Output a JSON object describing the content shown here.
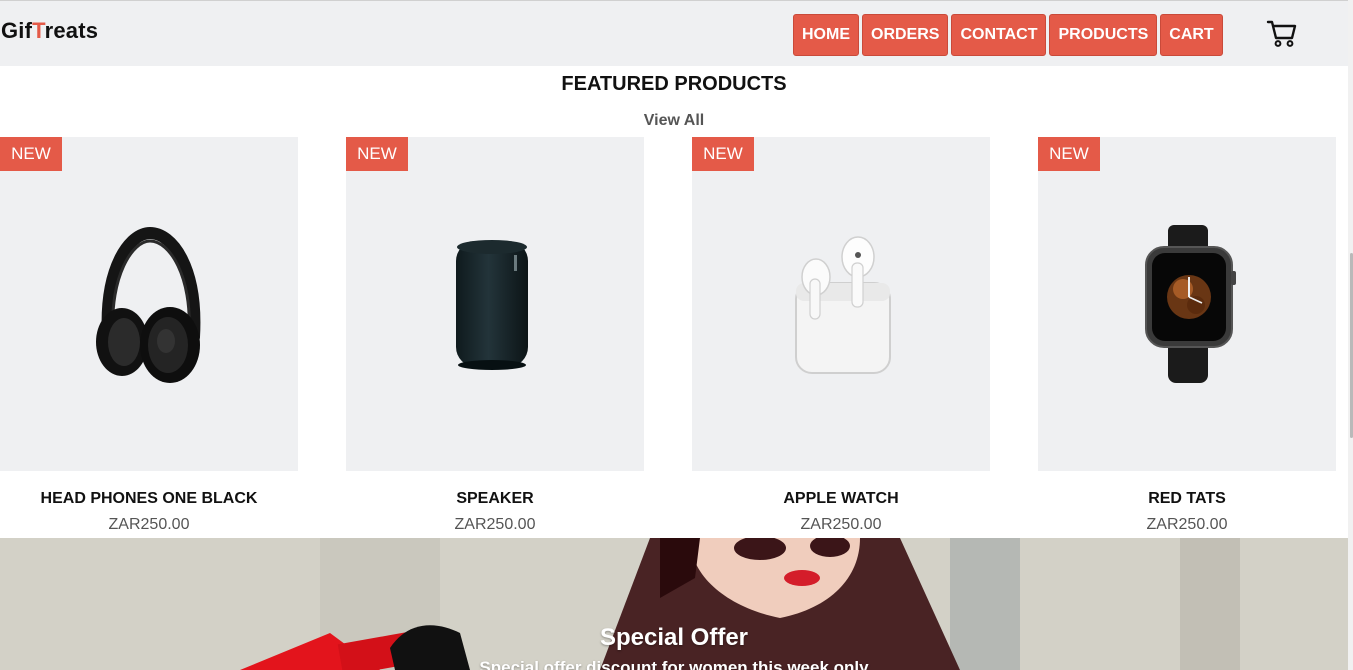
{
  "brand": {
    "logo_part1": "Gif",
    "logo_accent": "T",
    "logo_part2": "reats",
    "accent_color": "#e45a48"
  },
  "nav": {
    "items": [
      "HOME",
      "ORDERS",
      "CONTACT",
      "PRODUCTS",
      "CART"
    ],
    "cart_icon": "cart-icon"
  },
  "featured": {
    "title": "FEATURED PRODUCTS",
    "view_all": "View All",
    "products": [
      {
        "badge": "NEW",
        "name": "HEAD PHONES ONE BLACK",
        "price": "ZAR250.00",
        "image": "headphones"
      },
      {
        "badge": "NEW",
        "name": "SPEAKER",
        "price": "ZAR250.00",
        "image": "speaker"
      },
      {
        "badge": "NEW",
        "name": "APPLE WATCH",
        "price": "ZAR250.00",
        "image": "earbuds"
      },
      {
        "badge": "NEW",
        "name": "RED TATS",
        "price": "ZAR250.00",
        "image": "smartwatch"
      }
    ]
  },
  "offer": {
    "title": "Special Offer",
    "subtitle": "Special offer discount for women this week only"
  }
}
